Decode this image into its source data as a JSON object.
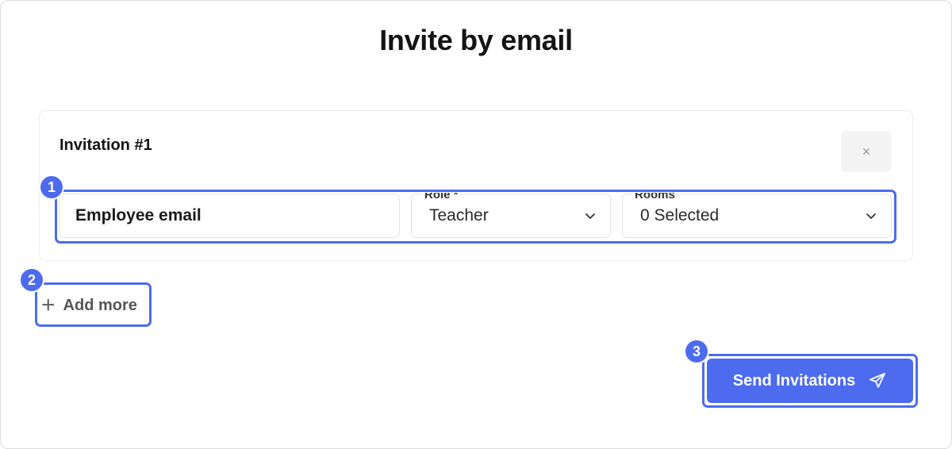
{
  "modal": {
    "title": "Invite by email"
  },
  "invitation": {
    "title": "Invitation #1",
    "close_label": "×",
    "email": {
      "placeholder": "Employee email"
    },
    "role": {
      "label": "Role *",
      "value": "Teacher"
    },
    "rooms": {
      "label": "Rooms",
      "value": "0 Selected"
    }
  },
  "actions": {
    "add_more_label": "Add more",
    "send_label": "Send Invitations"
  },
  "annotations": {
    "badge_1": "1",
    "badge_2": "2",
    "badge_3": "3"
  },
  "colors": {
    "accent": "#4c6bef",
    "highlight": "#4c6bef"
  }
}
